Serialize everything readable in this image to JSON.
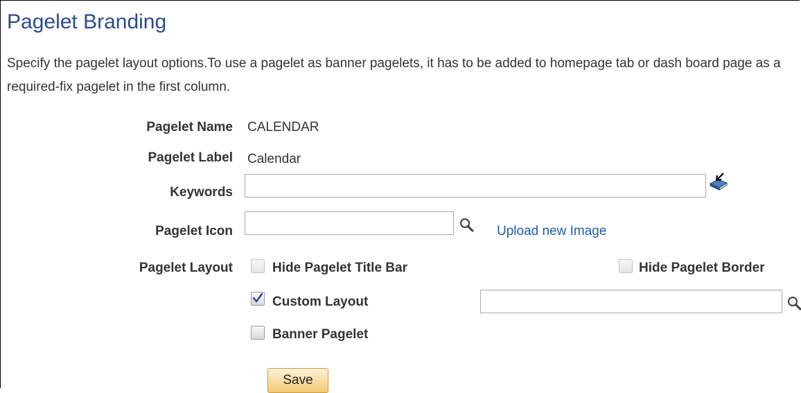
{
  "page": {
    "title": "Pagelet Branding",
    "description": "Specify the pagelet layout options.To use a pagelet as banner pagelets, it has to be added to homepage tab or dash board page as a required-fix pagelet in the first column."
  },
  "form": {
    "pagelet_name_label": "Pagelet Name",
    "pagelet_name_value": "CALENDAR",
    "pagelet_label_label": "Pagelet Label",
    "pagelet_label_value": "Calendar",
    "keywords_label": "Keywords",
    "keywords_value": "",
    "pagelet_icon_label": "Pagelet Icon",
    "pagelet_icon_value": "",
    "upload_link": "Upload new Image",
    "layout_label": "Pagelet Layout",
    "hide_title_bar": {
      "label": "Hide Pagelet Title Bar",
      "checked": false,
      "disabled": true
    },
    "hide_border": {
      "label": "Hide Pagelet Border",
      "checked": false,
      "disabled": true
    },
    "custom_layout": {
      "label": "Custom Layout",
      "checked": true,
      "value": ""
    },
    "banner_pagelet": {
      "label": "Banner Pagelet",
      "checked": false
    }
  },
  "actions": {
    "save_label": "Save"
  },
  "icons": {
    "keywords_icon": "spellcheck-book-icon",
    "pagelet_icon_lookup": "search-icon",
    "custom_layout_lookup": "search-icon"
  },
  "colors": {
    "title": "#2c4b8d",
    "link": "#1f5fa8",
    "button": "#f2c874"
  }
}
